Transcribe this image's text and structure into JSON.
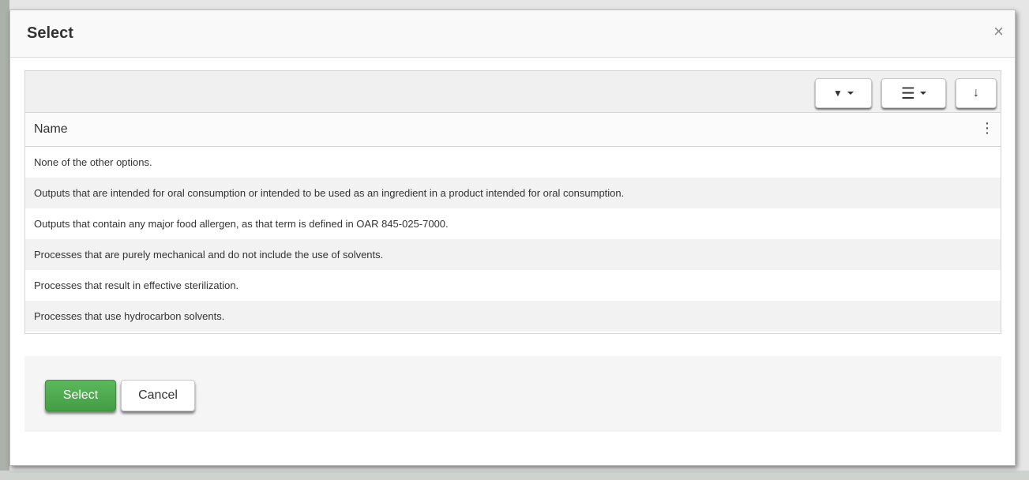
{
  "modal": {
    "title": "Select",
    "close_glyph": "×"
  },
  "toolbar": {
    "filter_icon": "filter-icon",
    "filter_glyph": "▼",
    "columns_icon": "menu-lines-icon",
    "columns_glyph": "☰",
    "export_icon": "download-arrow-icon",
    "export_glyph": "↓"
  },
  "grid": {
    "column_header": "Name",
    "column_menu_glyph": "⋮",
    "rows": [
      "None of the other options.",
      "Outputs that are intended for oral consumption or intended to be used as an ingredient in a product intended for oral consumption.",
      "Outputs that contain any major food allergen, as that term is defined in OAR 845-025-7000.",
      "Processes that are purely mechanical and do not include the use of solvents.",
      "Processes that result in effective sterilization.",
      "Processes that use hydrocarbon solvents."
    ]
  },
  "footer": {
    "select_label": "Select",
    "cancel_label": "Cancel"
  },
  "colors": {
    "primary_green": "#5cb85c",
    "header_bg": "#f9f9f9",
    "stripe_bg": "#f2f2f2"
  }
}
